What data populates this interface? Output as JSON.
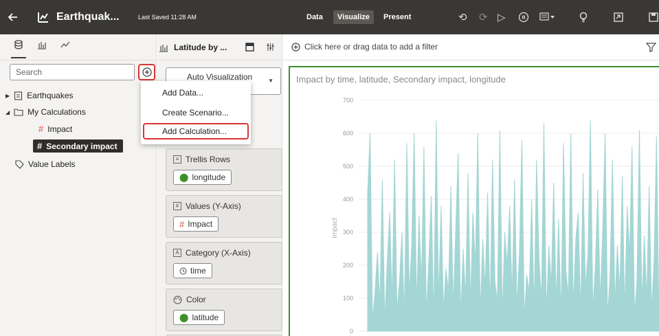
{
  "topbar": {
    "title": "Earthquak...",
    "last_saved": "Last Saved 11:28 AM",
    "tabs": [
      {
        "label": "Data"
      },
      {
        "label": "Visualize"
      },
      {
        "label": "Present"
      }
    ],
    "active_tab": "Visualize"
  },
  "left_panel": {
    "search_placeholder": "Search",
    "tree": {
      "earthquakes": "Earthquakes",
      "my_calculations": "My Calculations",
      "impact": "Impact",
      "secondary_impact": "Secondary impact",
      "value_labels": "Value Labels"
    }
  },
  "context_menu": {
    "items": [
      "Add Data...",
      "Create Scenario...",
      "Add Calculation..."
    ]
  },
  "mid_panel": {
    "viz_name": "Latitude by ...",
    "viz_type": "Auto Visualization",
    "wells": [
      {
        "title": "Trellis Rows",
        "pill": "longitude"
      },
      {
        "title": "Values (Y-Axis)",
        "pill": "Impact"
      },
      {
        "title": "Category (X-Axis)",
        "pill": "time"
      },
      {
        "title": "Color",
        "pill": "latitude"
      }
    ]
  },
  "filter_bar": {
    "text": "Click here or drag data to add a filter"
  },
  "chart_data": {
    "type": "area",
    "title": "Impact by time, latitude, Secondary impact, longitude",
    "ylabel": "Impact",
    "xlabel": "",
    "ylim": [
      0,
      700
    ],
    "y_ticks": [
      0,
      100,
      200,
      300,
      400,
      500,
      600,
      700
    ],
    "grid": true,
    "color": "#a3d6d4",
    "series": [
      {
        "values": [
          420,
          600,
          30,
          120,
          240,
          80,
          460,
          30,
          210,
          360,
          90,
          520,
          60,
          150,
          300,
          40,
          570,
          110,
          260,
          600,
          70,
          350,
          140,
          560,
          50,
          220,
          410,
          30,
          640,
          90,
          380,
          60,
          190,
          120,
          440,
          70,
          320,
          540,
          40,
          250,
          100,
          480,
          80,
          360,
          200,
          600,
          50,
          280,
          130,
          420,
          60,
          520,
          150,
          90,
          610,
          40,
          300,
          200,
          380,
          100,
          460,
          70,
          240,
          580,
          40,
          170,
          120,
          400,
          60,
          520,
          220,
          90,
          630,
          50,
          260,
          140,
          450,
          80,
          340,
          40,
          570,
          180,
          110,
          600,
          70,
          280,
          360,
          50,
          480,
          130,
          240,
          640,
          60,
          200,
          430,
          90,
          310,
          600,
          40,
          170,
          520,
          80,
          260,
          120,
          470,
          60,
          380,
          230,
          560,
          50,
          150,
          610,
          80,
          290,
          100,
          440,
          60,
          220,
          590,
          40
        ]
      }
    ]
  }
}
